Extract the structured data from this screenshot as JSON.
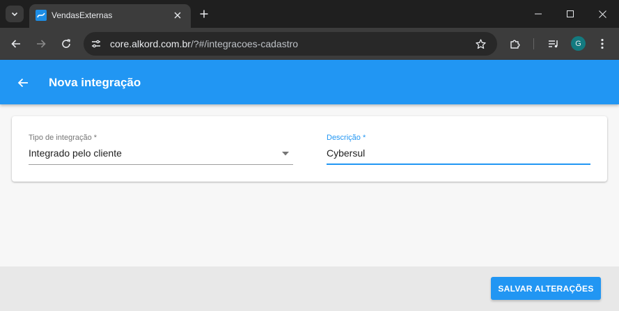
{
  "browser": {
    "tab_title": "VendasExternas",
    "url_host": "core.alkord.com.br",
    "url_path": "/?#/integracoes-cadastro",
    "profile_initial": "G",
    "icons": [
      "tab-search-icon",
      "favicon",
      "close-icon",
      "plus-icon",
      "minimize-icon",
      "maximize-icon",
      "close-window-icon",
      "back-arrow-icon",
      "forward-arrow-icon",
      "reload-icon",
      "site-info-icon",
      "star-icon",
      "extensions-icon",
      "media-controls-icon",
      "more-vert-icon"
    ]
  },
  "appbar": {
    "title": "Nova integração",
    "color": "#2196f3"
  },
  "form": {
    "tipo_label": "Tipo de integração *",
    "tipo_value": "Integrado pelo cliente",
    "descricao_label": "Descrição *",
    "descricao_value": "Cybersul"
  },
  "footer": {
    "save_label": "SALVAR ALTERAÇÕES"
  }
}
